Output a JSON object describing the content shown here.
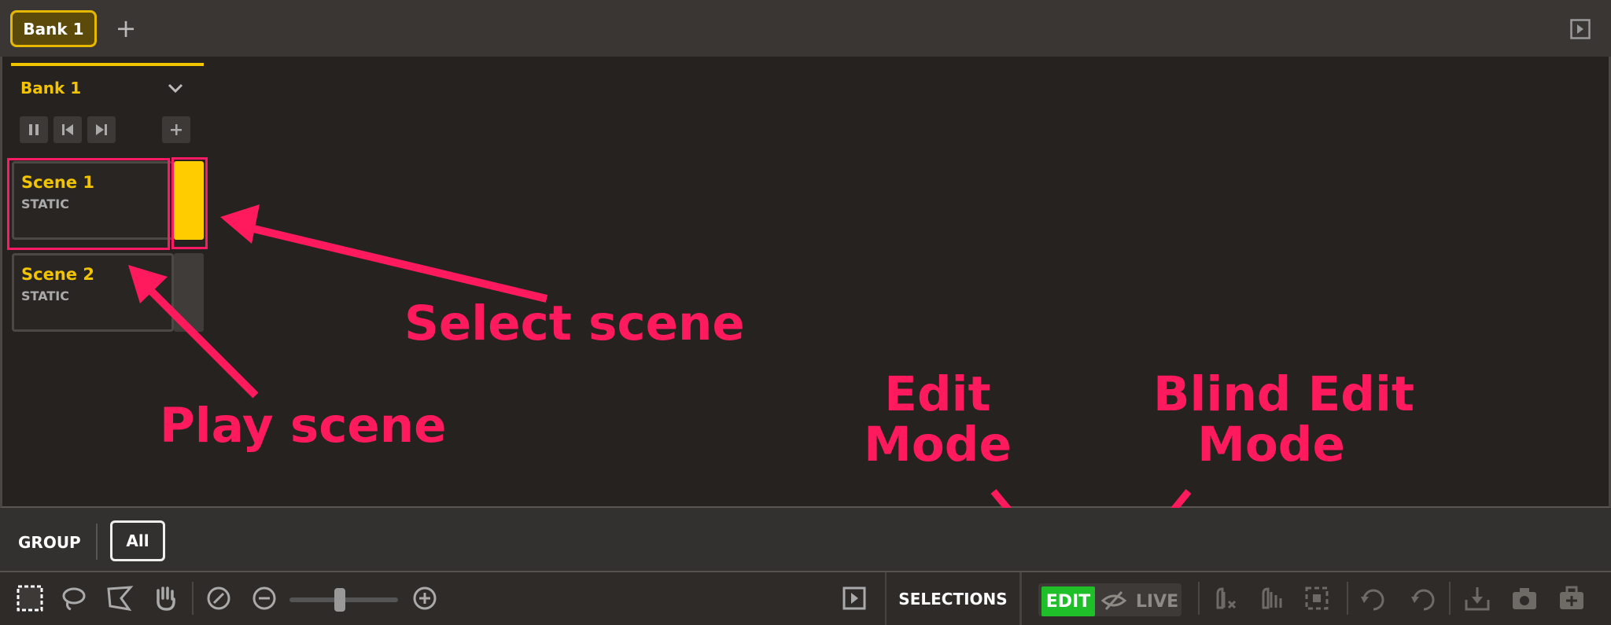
{
  "top_bar": {
    "bank_tab_label": "Bank 1",
    "add_tab_symbol": "+"
  },
  "bank_panel": {
    "bank_name": "Bank 1",
    "controls": [
      "pause-icon",
      "previous-icon",
      "next-icon",
      "add-icon"
    ],
    "scenes": [
      {
        "name": "Scene 1",
        "type": "STATIC",
        "active": true
      },
      {
        "name": "Scene 2",
        "type": "STATIC",
        "active": false
      }
    ]
  },
  "annotations": {
    "select_scene": "Select scene",
    "play_scene": "Play scene",
    "edit_mode_line1": "Edit",
    "edit_mode_line2": "Mode",
    "blind_edit_line1": "Blind Edit",
    "blind_edit_line2": "Mode"
  },
  "group_bar": {
    "label": "GROUP",
    "all_button": "All"
  },
  "toolbar": {
    "selections_label": "SELECTIONS",
    "edit_label": "EDIT",
    "live_label": "LIVE",
    "right_icons": [
      "clear-fixtures-icon",
      "clear-values-icon",
      "select-all-fixtures-icon",
      "reset-all-icon",
      "reset-selected-icon",
      "save-icon",
      "snapshot-icon",
      "presets-icon"
    ]
  },
  "colors": {
    "accent": "#f2c400",
    "annotation": "#ff1a5e",
    "edit_active": "#1fbf2a"
  }
}
